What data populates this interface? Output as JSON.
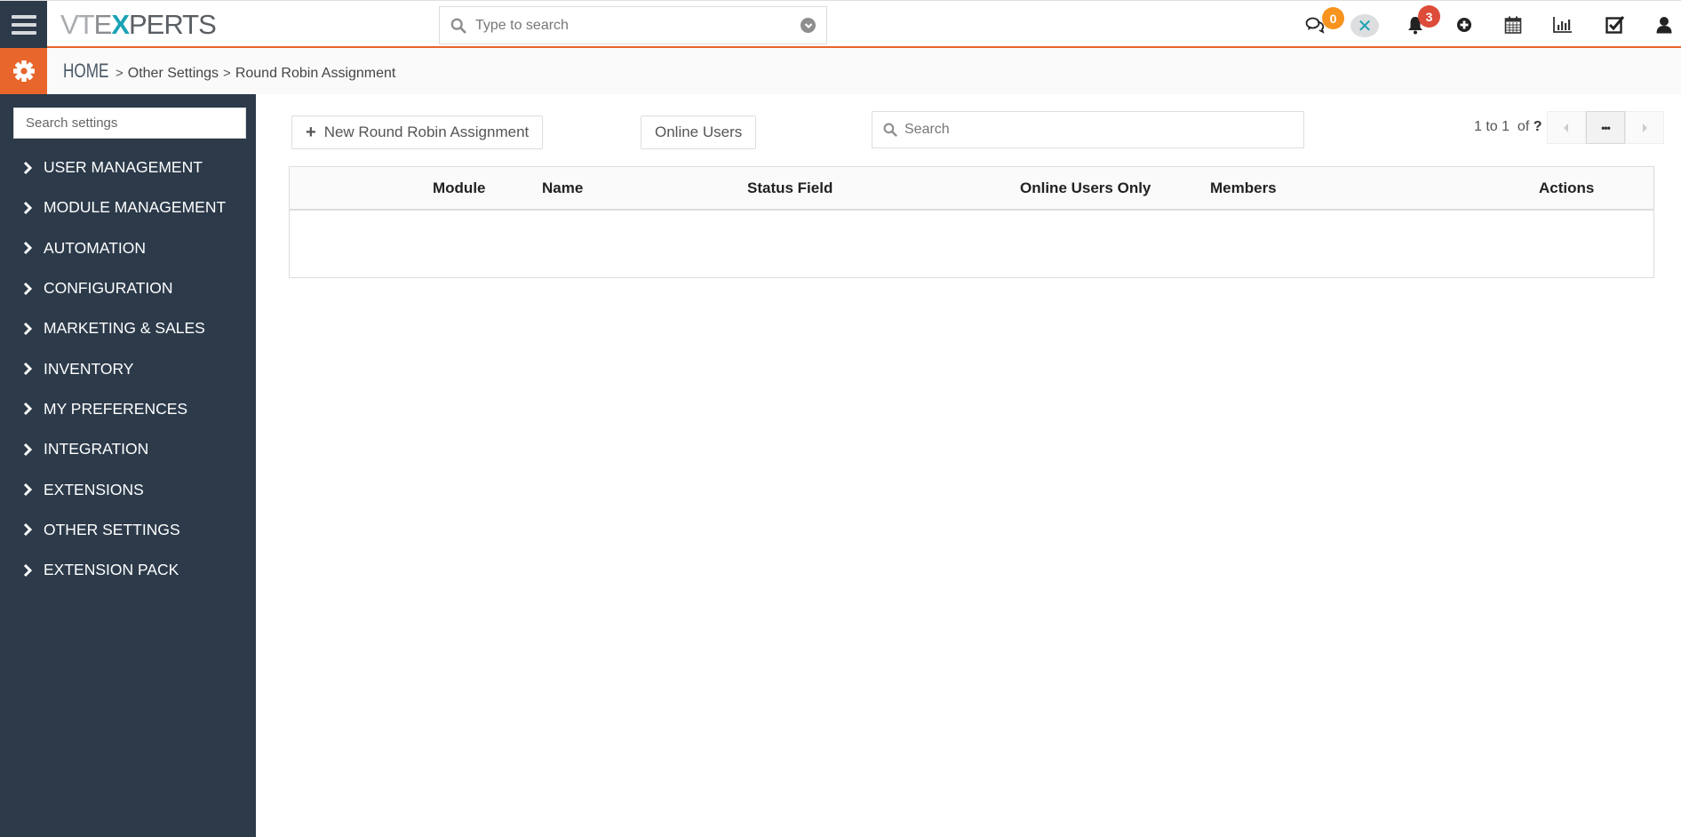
{
  "topbar": {
    "logo": {
      "part1": "VT",
      "part2": "E",
      "part3": "X",
      "part4": "PERTS"
    },
    "search_placeholder": "Type to search",
    "chat_badge": "0",
    "notification_badge": "3",
    "icons": [
      "menu-icon",
      "chat-icon",
      "vtexperts-x-icon",
      "bell-icon",
      "plus-circle-icon",
      "calendar-icon",
      "chart-icon",
      "checkbox-icon",
      "user-icon"
    ]
  },
  "breadcrumb": {
    "home": "HOME",
    "items": [
      "Other Settings",
      "Round Robin Assignment"
    ],
    "separator": ">"
  },
  "sidebar": {
    "search_placeholder": "Search settings",
    "items": [
      {
        "label": "USER MANAGEMENT"
      },
      {
        "label": "MODULE MANAGEMENT"
      },
      {
        "label": "AUTOMATION"
      },
      {
        "label": "CONFIGURATION"
      },
      {
        "label": "MARKETING & SALES"
      },
      {
        "label": "INVENTORY"
      },
      {
        "label": "MY PREFERENCES"
      },
      {
        "label": "INTEGRATION"
      },
      {
        "label": "EXTENSIONS"
      },
      {
        "label": "OTHER SETTINGS"
      },
      {
        "label": "EXTENSION PACK"
      }
    ]
  },
  "toolbar": {
    "new_button": "New Round Robin Assignment",
    "online_users_button": "Online Users",
    "search_placeholder": "Search",
    "pagination": {
      "range": "1 to 1",
      "of_label": "of",
      "total": "?",
      "more": "•••"
    }
  },
  "table": {
    "columns": [
      "Module",
      "Name",
      "Status Field",
      "Online Users Only",
      "Members",
      "Actions"
    ],
    "rows": []
  },
  "colors": {
    "accent": "#e8652b",
    "sidebar_bg": "#2c3a4a",
    "badge_orange": "#f7931e",
    "badge_red": "#dd4b39",
    "logo_x": "#1aa3b5"
  }
}
